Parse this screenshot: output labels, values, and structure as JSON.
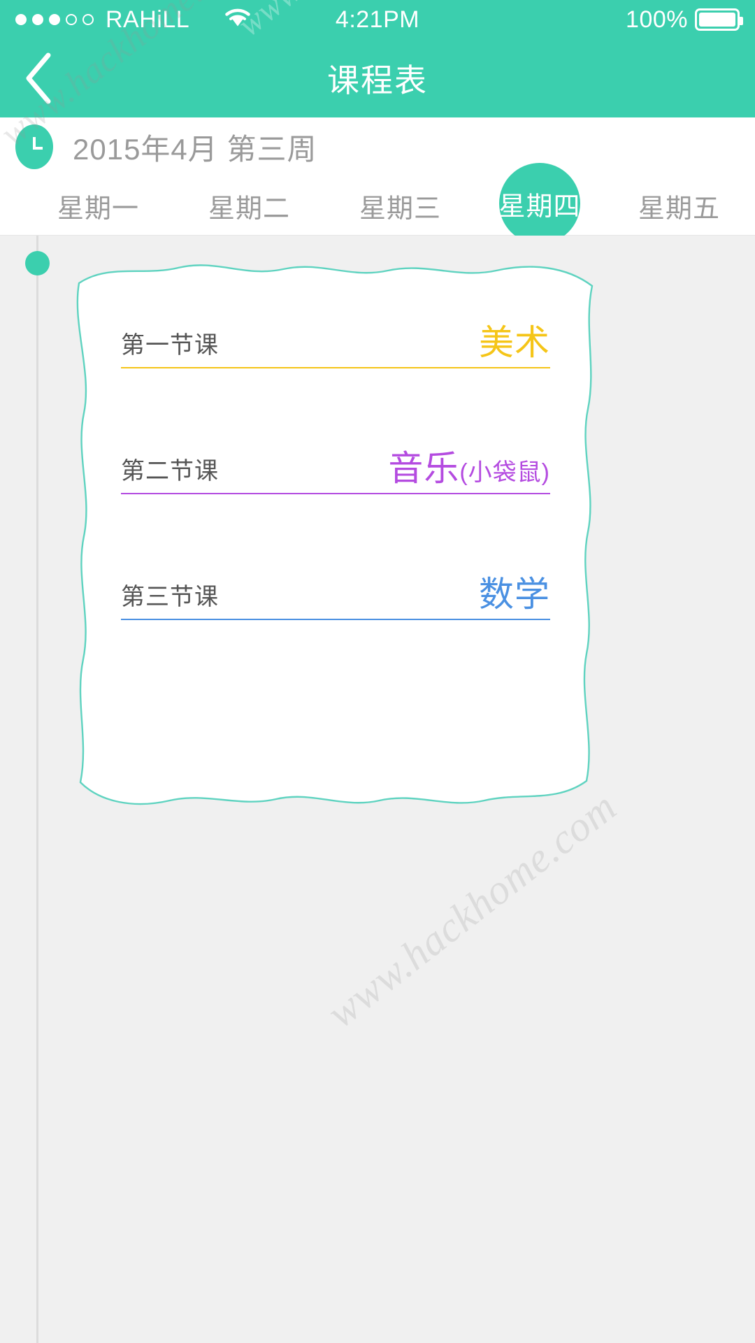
{
  "statusbar": {
    "signal_dots": [
      true,
      true,
      true,
      false,
      false
    ],
    "carrier": "RAHiLL",
    "wifi_icon": "wifi-icon",
    "time": "4:21PM",
    "battery_percent": "100%",
    "battery_level": 100
  },
  "navbar": {
    "back_icon": "chevron-left-icon",
    "title": "课程表"
  },
  "header": {
    "clock_icon": "clock-icon",
    "date_text": "2015年4月  第三周",
    "weekdays": [
      {
        "label": "星期一",
        "active": false
      },
      {
        "label": "星期二",
        "active": false
      },
      {
        "label": "星期三",
        "active": false
      },
      {
        "label": "星期四",
        "active": true
      },
      {
        "label": "星期五",
        "active": false
      }
    ]
  },
  "schedule": {
    "courses": [
      {
        "period": "第一节课",
        "subject": "美术",
        "note": "",
        "color": "#F5C518"
      },
      {
        "period": "第二节课",
        "subject": "音乐",
        "note": "(小袋鼠)",
        "color": "#B44BE0"
      },
      {
        "period": "第三节课",
        "subject": "数学",
        "note": "",
        "color": "#4A90E2"
      }
    ]
  },
  "theme": {
    "accent": "#3BCFAE",
    "statusbar_bg": "#3BCFAE",
    "page_bg": "#f0f0f0",
    "card_border": "#5FD3C0",
    "muted_text": "#9a9a9a"
  },
  "watermarks": {
    "text": "www.hackhome.com"
  }
}
